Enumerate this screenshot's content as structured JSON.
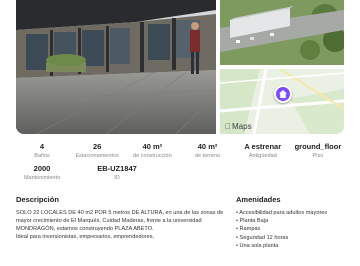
{
  "gallery": {
    "maps_label": "Maps"
  },
  "stats": [
    {
      "value": "4",
      "label": "Baños"
    },
    {
      "value": "26",
      "label": "Estacionamientos"
    },
    {
      "value": "40 m²",
      "label": "de construcción"
    },
    {
      "value": "40 m²",
      "label": "de terreno"
    },
    {
      "value": "A estrenar",
      "label": "Antigüedad"
    },
    {
      "value": "ground_floor",
      "label": "Piso"
    },
    {
      "value": "2000",
      "label": "Mantenimiento"
    },
    {
      "value": "EB-UZ1847",
      "label": "ID"
    }
  ],
  "description": {
    "title": "Descripción",
    "paragraph_1": "SOLO 22 LOCALES DE 40 m2 POR 5 metros DE ALTURA, en una de las zonas de mayor crecimiento de El Marqués, Cuidad Maderas, frente a la universidad MONDRAGÓN, estamos construyendo PLAZA ABETO.",
    "paragraph_2": "Ideal para inversionistas, empresarios, emprendedores,"
  },
  "amenities": {
    "title": "Amenidades",
    "items": [
      "Accesibilidad para adultos mayores",
      "Planta Baja",
      "Rampas",
      "Seguridad 12 horas",
      "Una sola planta"
    ]
  },
  "colors": {
    "pin": "#7b4dff"
  }
}
